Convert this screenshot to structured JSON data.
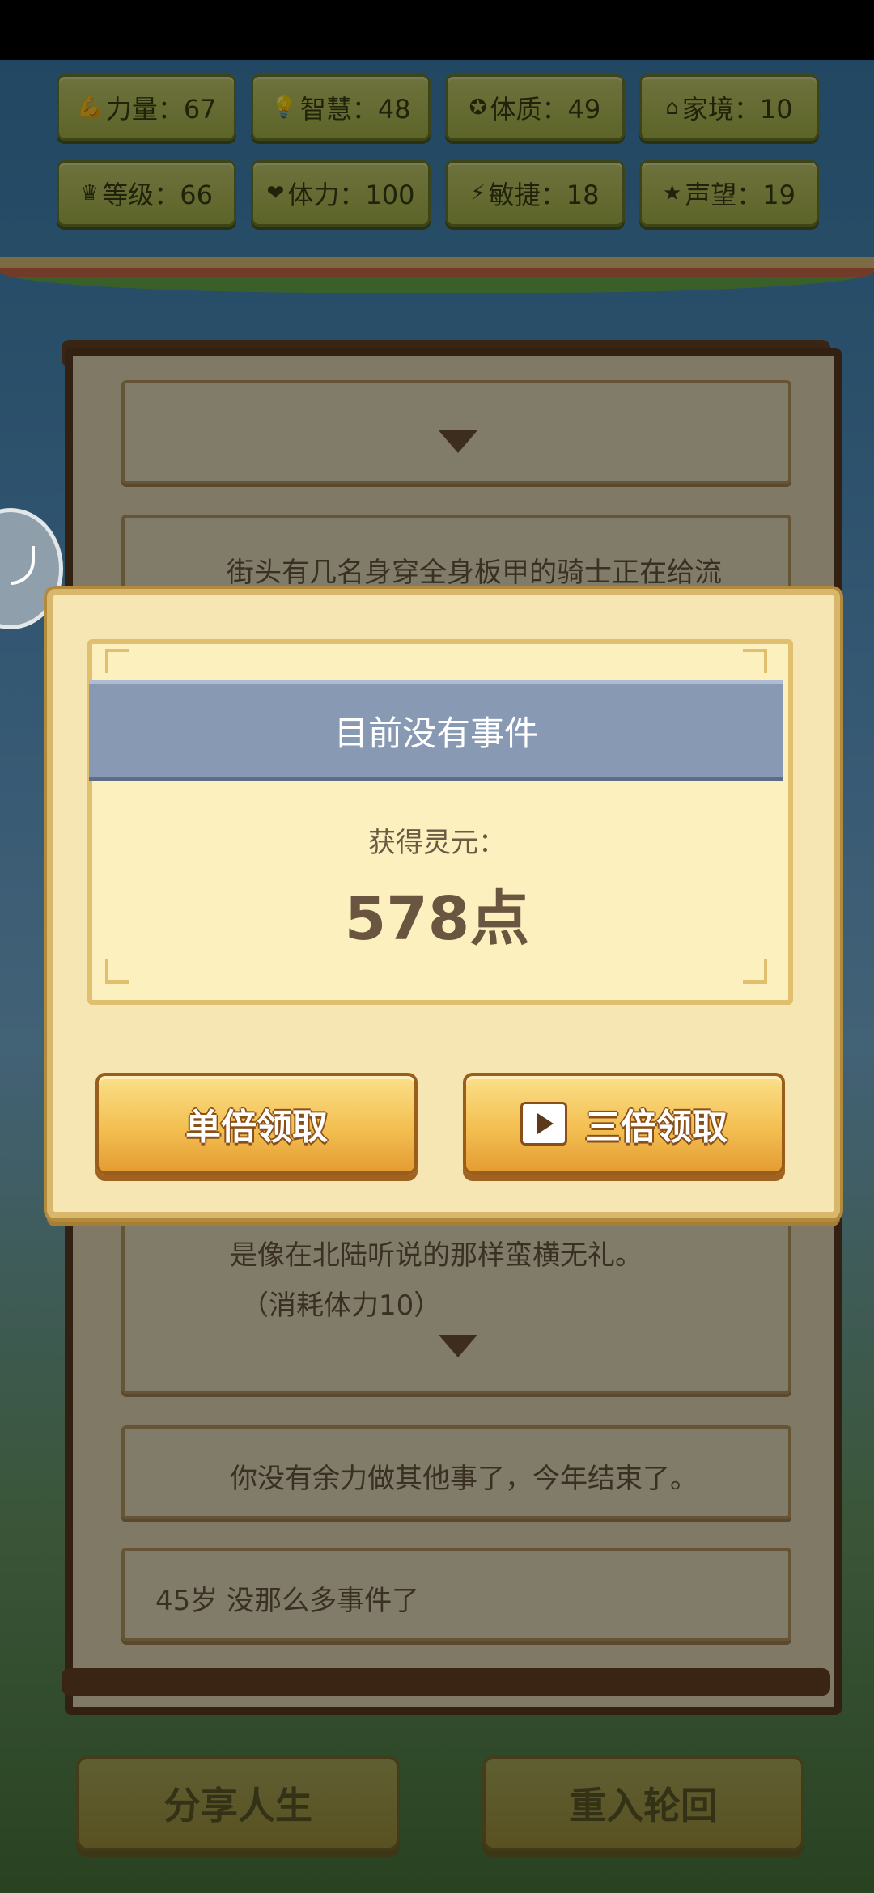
{
  "stats": [
    {
      "icon": "muscle-icon",
      "glyph": "💪",
      "label": "力量：67"
    },
    {
      "icon": "bulb-icon",
      "glyph": "💡",
      "label": "智慧：48"
    },
    {
      "icon": "physique-icon",
      "glyph": "✪",
      "label": "体质：49"
    },
    {
      "icon": "home-icon",
      "glyph": "⌂",
      "label": "家境：10"
    },
    {
      "icon": "crown-icon",
      "glyph": "♛",
      "label": "等级：66"
    },
    {
      "icon": "heart-icon",
      "glyph": "❤",
      "label": "体力：100"
    },
    {
      "icon": "lightning-icon",
      "glyph": "⚡",
      "label": "敏捷：18"
    },
    {
      "icon": "star-icon",
      "glyph": "★",
      "label": "声望：19"
    }
  ],
  "log": {
    "event_preview": "街头有几名身穿全身板甲的骑士正在给流",
    "event_continued": "是像在北陆听说的那样蛮横无礼。",
    "event_cost": "（消耗体力10）",
    "end_of_year": "你没有余力做其他事了，今年结束了。",
    "age_note": "45岁 没那么多事件了"
  },
  "bottom_buttons": {
    "share": "分享人生",
    "restart": "重入轮回"
  },
  "modal": {
    "title": "目前没有事件",
    "reward_label": "获得灵元：",
    "reward_value": "578点",
    "single_claim": "单倍领取",
    "triple_claim": "三倍领取"
  }
}
